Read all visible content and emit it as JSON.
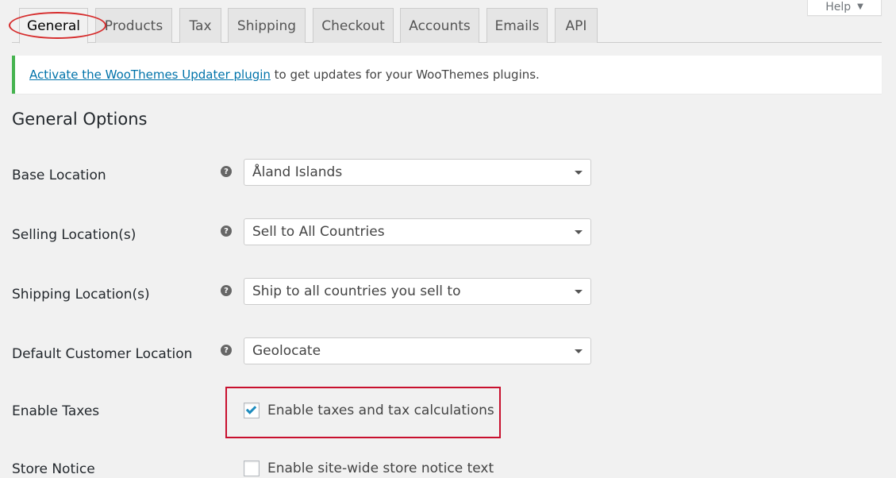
{
  "help": {
    "label": "Help",
    "caret": "▼"
  },
  "tabs": [
    {
      "label": "General",
      "active": true
    },
    {
      "label": "Products"
    },
    {
      "label": "Tax"
    },
    {
      "label": "Shipping"
    },
    {
      "label": "Checkout"
    },
    {
      "label": "Accounts"
    },
    {
      "label": "Emails"
    },
    {
      "label": "API"
    }
  ],
  "notice": {
    "link_text": "Activate the WooThemes Updater plugin",
    "text": " to get updates for your WooThemes plugins."
  },
  "section_title": "General Options",
  "fields": {
    "base_location": {
      "label": "Base Location",
      "value": "Åland Islands"
    },
    "selling_location": {
      "label": "Selling Location(s)",
      "value": "Sell to All Countries"
    },
    "shipping_location": {
      "label": "Shipping Location(s)",
      "value": "Ship to all countries you sell to"
    },
    "default_customer_location": {
      "label": "Default Customer Location",
      "value": "Geolocate"
    },
    "enable_taxes": {
      "label": "Enable Taxes",
      "checkbox_label": "Enable taxes and tax calculations",
      "checked": true
    },
    "store_notice": {
      "label": "Store Notice",
      "checkbox_label": "Enable site-wide store notice text",
      "checked": false
    }
  },
  "help_icon_glyph": "?",
  "colors": {
    "accent_link": "#0073aa",
    "notice_success": "#46b450",
    "annotation_red": "#d62d2d",
    "checkbox_tick": "#1e8cbe"
  }
}
